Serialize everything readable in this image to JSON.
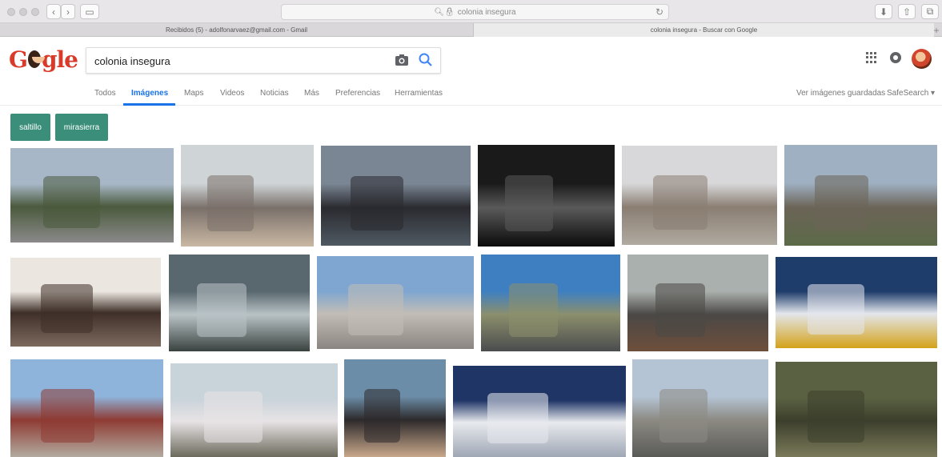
{
  "browser": {
    "url_text": "colonia insegura",
    "tabs": [
      "Recibidos (5) - adolfonarvaez@gmail.com - Gmail",
      "colonia insegura - Buscar con Google"
    ]
  },
  "google": {
    "logo_text_start": "G",
    "logo_text_end": "gle",
    "search_value": "colonia insegura",
    "nav": [
      "Todos",
      "Imágenes",
      "Maps",
      "Videos",
      "Noticias",
      "Más",
      "Preferencias",
      "Herramientas"
    ],
    "saved_images": "Ver imágenes guardadas",
    "safesearch": "SafeSearch ▾",
    "chips": [
      "saltillo",
      "mirasierra"
    ]
  },
  "results": [
    {
      "label": "street-with-walker",
      "colors": [
        "#a7b7c7",
        "#4b5a3d",
        "#8a8a8a"
      ]
    },
    {
      "label": "masked-thief-at-car",
      "colors": [
        "#cfd4d6",
        "#7a706a",
        "#c9b8a3"
      ]
    },
    {
      "label": "police-crowd",
      "colors": [
        "#7a8694",
        "#2a2a2f",
        "#4f5963"
      ]
    },
    {
      "label": "dark-alley-night",
      "colors": [
        "#1a1a1a",
        "#5a5a5a",
        "#0a0a0a"
      ]
    },
    {
      "label": "sidewalk-with-people",
      "colors": [
        "#d8d8da",
        "#8a7e72",
        "#b0aaa0"
      ]
    },
    {
      "label": "woman-walking-road",
      "colors": [
        "#9fb0c2",
        "#6b6457",
        "#5c6a48"
      ]
    },
    {
      "label": "crowbar-car-door",
      "colors": [
        "#ece6e0",
        "#3e2f28",
        "#7d6a5f"
      ]
    },
    {
      "label": "stormy-sky-street",
      "colors": [
        "#59686f",
        "#b9c3c6",
        "#39423f"
      ]
    },
    {
      "label": "empty-street-houses",
      "colors": [
        "#7fa6d0",
        "#c2bdb6",
        "#8a8580"
      ]
    },
    {
      "label": "street-with-cars",
      "colors": [
        "#3e7fc2",
        "#8c8f6c",
        "#4a4c4e"
      ]
    },
    {
      "label": "neighbors-gathering",
      "colors": [
        "#aab0ad",
        "#4b4846",
        "#6e4f3b"
      ]
    },
    {
      "label": "ambulance-scene",
      "colors": [
        "#1f3d6b",
        "#e3e6ec",
        "#d4a21a"
      ]
    },
    {
      "label": "colonial-street",
      "colors": [
        "#8fb4dc",
        "#8e3b33",
        "#b3aba0"
      ]
    },
    {
      "label": "protest-banner-street",
      "colors": [
        "#c9d3da",
        "#e7e3e5",
        "#6c6a5c"
      ]
    },
    {
      "label": "crowd-meeting",
      "colors": [
        "#6c8da8",
        "#2d2a2b",
        "#c9a88b"
      ]
    },
    {
      "label": "police-cars-camera",
      "colors": [
        "#1f3566",
        "#e8eaee",
        "#9fa7b5"
      ]
    },
    {
      "label": "toluca-street",
      "colors": [
        "#b5c4d4",
        "#8c8a83",
        "#5a5a57"
      ]
    },
    {
      "label": "soldiers-line",
      "colors": [
        "#5a6142",
        "#3c3f2c",
        "#7b7a5a"
      ]
    }
  ]
}
